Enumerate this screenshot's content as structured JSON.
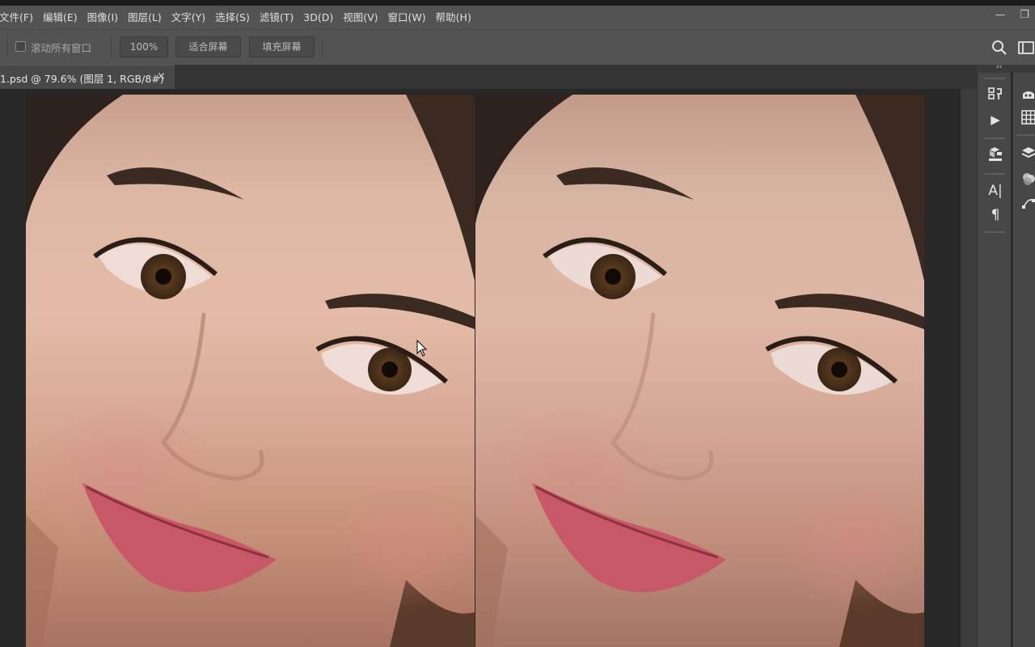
{
  "menubar": {
    "items": [
      {
        "id": "file",
        "label": "文件(F)"
      },
      {
        "id": "edit",
        "label": "编辑(E)"
      },
      {
        "id": "image",
        "label": "图像(I)"
      },
      {
        "id": "layer",
        "label": "图层(L)"
      },
      {
        "id": "type",
        "label": "文字(Y)"
      },
      {
        "id": "select",
        "label": "选择(S)"
      },
      {
        "id": "filter",
        "label": "滤镜(T)"
      },
      {
        "id": "3d",
        "label": "3D(D)"
      },
      {
        "id": "view",
        "label": "视图(V)"
      },
      {
        "id": "window",
        "label": "窗口(W)"
      },
      {
        "id": "help",
        "label": "帮助(H)"
      }
    ],
    "minimize_glyph": "—",
    "restore_glyph": "❐"
  },
  "options_bar": {
    "scroll_all_windows_label": "滚动所有窗口",
    "zoom_100_label": "100%",
    "fit_screen_label": "适合屏幕",
    "fill_screen_label": "填充屏幕"
  },
  "document_tab": {
    "title": "1.psd @ 79.6% (图层 1, RGB/8#)",
    "close_glyph": "×"
  },
  "right_panel": {
    "collapse_glyph": "‹‹",
    "col1_icons": [
      "history-icon",
      "play-actions-icon",
      "3d-panel-icon",
      "character-icon",
      "paragraph-icon"
    ],
    "character_glyph": "A|",
    "paragraph_glyph": "¶",
    "play_glyph": "▶",
    "col2_icons": [
      "learn-icon",
      "swatches-grid-icon",
      "layers-icon",
      "channels-icon",
      "paths-icon"
    ]
  },
  "colors": {
    "menubar_bg": "#535353",
    "canvas_bg": "#282828",
    "panel_bg": "#474747"
  }
}
